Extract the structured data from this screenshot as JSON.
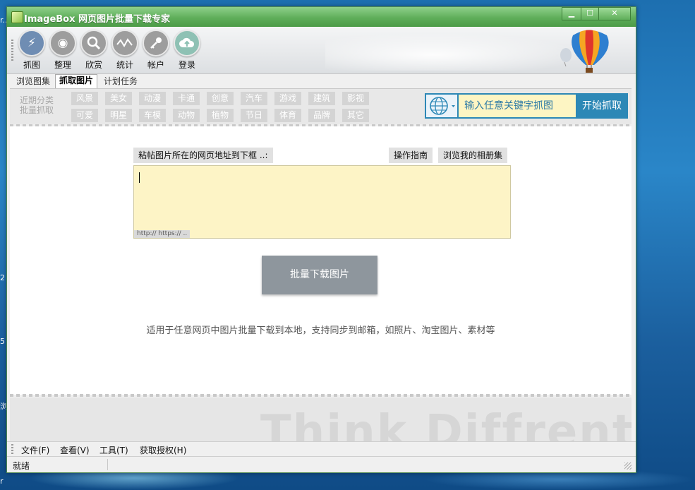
{
  "window": {
    "title": "ImageBox 网页图片批量下载专家"
  },
  "window_controls": {
    "minimize": "▁",
    "maximize": "☐",
    "close": "✕"
  },
  "toolbar": {
    "items": [
      {
        "label": "抓图",
        "icon": "lightning-icon",
        "color": "#6f8db3"
      },
      {
        "label": "整理",
        "icon": "target-icon",
        "color": "#9a9a9a"
      },
      {
        "label": "欣赏",
        "icon": "search-icon",
        "color": "#9a9a9a"
      },
      {
        "label": "统计",
        "icon": "chart-wave-icon",
        "color": "#9a9a9a"
      },
      {
        "label": "帐户",
        "icon": "key-icon",
        "color": "#9a9a9a"
      },
      {
        "label": "登录",
        "icon": "cloud-upload-icon",
        "color": "#8ec1b4"
      }
    ]
  },
  "tabs": [
    {
      "label": "浏览图集",
      "active": false
    },
    {
      "label": "抓取图片",
      "active": true
    },
    {
      "label": "计划任务",
      "active": false
    }
  ],
  "categories": {
    "note_line1": "近期分类",
    "note_line2": "批量抓取",
    "row1": [
      "风景",
      "美女",
      "动漫",
      "卡通",
      "创意",
      "汽车",
      "游戏",
      "建筑",
      "影视"
    ],
    "row2": [
      "可爱",
      "明星",
      "车模",
      "动物",
      "植物",
      "节日",
      "体育",
      "品牌",
      "其它"
    ]
  },
  "search": {
    "placeholder": "输入任意关键字抓图",
    "button": "开始抓取",
    "icon": "globe-icon"
  },
  "url_panel": {
    "paste_label": "粘帖图片所在的网页地址到下框 ..:",
    "guide_button": "操作指南",
    "album_button": "浏览我的相册集",
    "hint": "http:// https:// ..",
    "value": ""
  },
  "download_button": "批量下载图片",
  "description": "适用于任意网页中图片批量下载到本地，支持同步到邮箱，如照片、淘宝图片、素材等",
  "watermark": "Think Diffrent",
  "menubar": [
    "文件(F)",
    "查看(V)",
    "工具(T)",
    "获取授权(H)"
  ],
  "status": {
    "text": "就绪"
  },
  "colors": {
    "title_green": "#5fae5a",
    "search_blue": "#2d88b6",
    "input_yellow": "#fdf4c6"
  }
}
